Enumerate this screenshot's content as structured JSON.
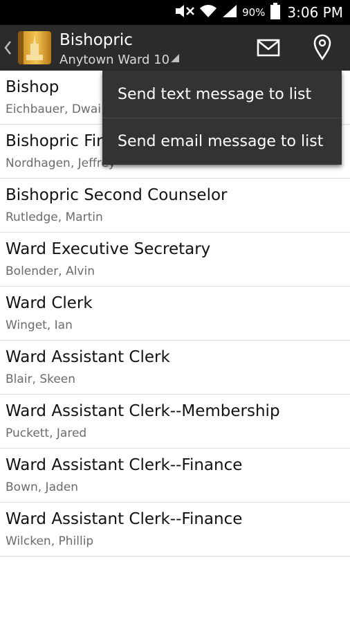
{
  "status_bar": {
    "battery_percent": "90%",
    "time": "3:06 PM",
    "icons": [
      "mute-icon",
      "wifi-icon",
      "signal-icon",
      "battery-icon"
    ]
  },
  "action_bar": {
    "title": "Bishopric",
    "subtitle": "Anytown Ward 10",
    "icons": [
      "up-caret-icon",
      "app-logo-icon",
      "spinner-triangle-icon",
      "mail-icon",
      "map-pin-icon"
    ]
  },
  "list": {
    "items": [
      {
        "title": "Bishop",
        "name": "Eichbauer, Dwai"
      },
      {
        "title": "Bishopric Fir",
        "name": "Nordhagen, Jeffrey"
      },
      {
        "title": "Bishopric Second Counselor",
        "name": "Rutledge, Martin"
      },
      {
        "title": "Ward Executive Secretary",
        "name": "Bolender, Alvin"
      },
      {
        "title": "Ward Clerk",
        "name": "Winget, Ian"
      },
      {
        "title": "Ward Assistant Clerk",
        "name": "Blair, Skeen"
      },
      {
        "title": "Ward Assistant Clerk--Membership",
        "name": "Puckett, Jared"
      },
      {
        "title": "Ward Assistant Clerk--Finance",
        "name": "Bown, Jaden"
      },
      {
        "title": "Ward Assistant Clerk--Finance",
        "name": "Wilcken, Phillip"
      }
    ]
  },
  "popup_menu": {
    "items": [
      {
        "label": "Send text message to list"
      },
      {
        "label": "Send email message to list"
      }
    ]
  }
}
